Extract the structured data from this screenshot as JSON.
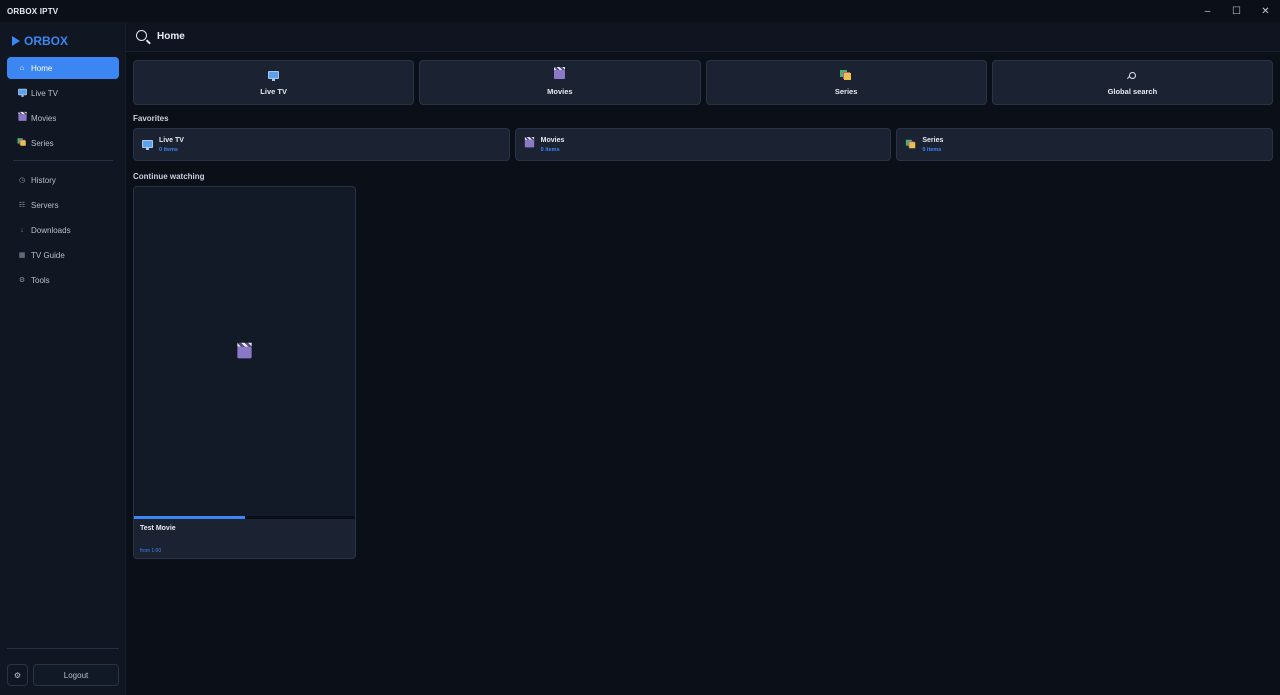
{
  "window": {
    "title": "ORBOX IPTV",
    "controls": {
      "minimize": "–",
      "maximize": "☐",
      "close": "✕"
    }
  },
  "sidebar": {
    "logo": "ORBOX",
    "primary_items": [
      {
        "label": "Home",
        "icon": "⌂",
        "icon_name": "home-icon",
        "active": true
      },
      {
        "label": "Live TV",
        "icon_name": "tv-icon"
      },
      {
        "label": "Movies",
        "icon_name": "clapper-icon"
      },
      {
        "label": "Series",
        "icon_name": "series-icon"
      }
    ],
    "secondary_items": [
      {
        "label": "History",
        "icon": "◷",
        "icon_name": "clock-icon"
      },
      {
        "label": "Servers",
        "icon": "☷",
        "icon_name": "list-icon"
      },
      {
        "label": "Downloads",
        "icon": "↓",
        "icon_name": "download-icon"
      },
      {
        "label": "TV Guide",
        "icon": "▦",
        "icon_name": "grid-icon"
      },
      {
        "label": "Tools",
        "icon": "⚙",
        "icon_name": "gear-icon"
      }
    ],
    "settings_icon": "⚙",
    "logout_label": "Logout"
  },
  "topbar": {
    "title": "Home"
  },
  "tiles": [
    {
      "label": "Live TV",
      "icon_name": "tv-icon"
    },
    {
      "label": "Movies",
      "icon_name": "clapper-icon"
    },
    {
      "label": "Series",
      "icon_name": "series-icon"
    },
    {
      "label": "Global search",
      "icon_name": "search-icon"
    }
  ],
  "favorites": {
    "title": "Favorites",
    "items": [
      {
        "name": "Live TV",
        "count": "0 items",
        "icon_name": "tv-icon"
      },
      {
        "name": "Movies",
        "count": "0 items",
        "icon_name": "clapper-icon"
      },
      {
        "name": "Series",
        "count": "0 items",
        "icon_name": "series-icon"
      }
    ]
  },
  "continue_watching": {
    "title": "Continue watching",
    "items": [
      {
        "title": "Test Movie",
        "subtitle": "from 1:00",
        "progress": 0.5,
        "icon_name": "clapper-icon"
      }
    ]
  },
  "colors": {
    "accent": "#3b86f3",
    "background": "#0b0f18",
    "sidebar": "#101622",
    "card": "#1b2332"
  }
}
